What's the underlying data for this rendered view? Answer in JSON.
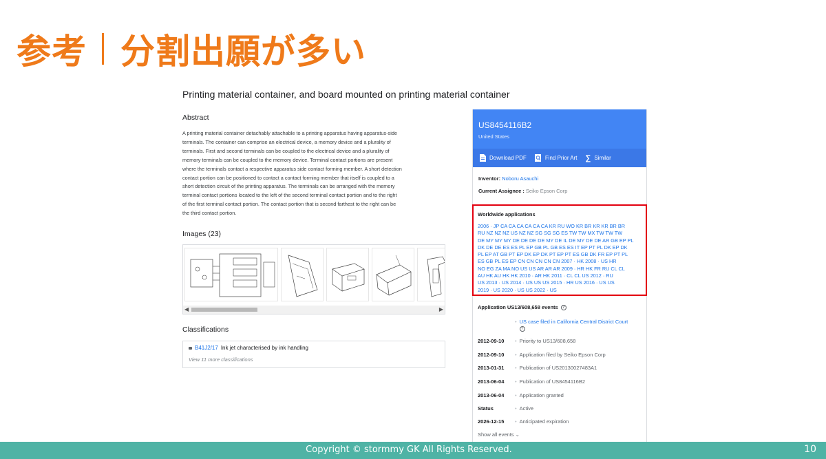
{
  "slide": {
    "title_left": "参考",
    "title_right": "分割出願が多い"
  },
  "patent": {
    "title": "Printing material container, and board mounted on printing material container",
    "abstract_heading": "Abstract",
    "abstract_lines": [
      "A printing material container detachably attachable to a printing apparatus having apparatus-side",
      "terminals. The container can comprise an electrical device, a memory device and a plurality of",
      "terminals. First and second terminals can be coupled to the electrical device and a plurality of",
      "memory terminals can be coupled to the memory device. Terminal contact portions are present",
      "where the terminals contact a respective apparatus side contact forming member. A short detection",
      "contact portion can be positioned to contact a contact forming member that itself is coupled to a",
      "short detection circuit of the printing apparatus. The terminals can be arranged with the memory",
      "terminal contact portions located to the left of the second terminal contact portion and to the right",
      "of the first terminal contact portion. The contact portion that is second farthest to the right can be",
      "the third contact portion."
    ],
    "images_heading": "Images (23)",
    "classifications_heading": "Classifications",
    "classification": {
      "code": "B41J2/17",
      "description": "Ink jet characterised by ink handling"
    },
    "more_classifications": "View 11 more classifications"
  },
  "card": {
    "number": "US8454116B2",
    "country": "United States",
    "actions": {
      "download": "Download PDF",
      "prior_art": "Find Prior Art",
      "similar": "Similar"
    },
    "inventor_label": "Inventor:",
    "inventor": "Noboru Asauchi",
    "assignee_label": "Current Assignee :",
    "assignee": "Seiko Epson Corp",
    "worldwide_title": "Worldwide applications",
    "worldwide_lines": [
      "2006 · JP CA CA CA CA CA CA KR RU WO KR BR KR KR BR BR",
      "RU NZ NZ NZ US NZ NZ SG SG SG ES TW TW MX TW TW TW",
      "DE MY MY MY DE DE DE DE MY DE IL DE MY DE DE AR GB EP PL",
      "DK DE DE ES ES PL EP GB PL GB ES ES IT EP PT PL DK EP DK",
      "PL EP AT GB PT EP DK EP DK PT EP PT ES GB DK FR EP PT PL",
      "ES GB PL ES EP CN CN CN CN CN   2007 · HK   2008 · US HR",
      "NO EG ZA MA NO US US AR AR AR   2009 · HR HK FR RU CL CL",
      "AU HK AU HK HK   2010 · AR HK   2011 · CL CL US   2012 · RU",
      "US   2013 · US   2014 · US US US   2015 · HR US   2016 · US US",
      "2019 · US   2020 · US US   2022 · US"
    ],
    "events_title": "Application US13/608,658 events",
    "events": [
      {
        "date": "",
        "desc": "US case filed in California Central District Court"
      },
      {
        "date": "2012-09-10",
        "desc": "Priority to US13/608,658"
      },
      {
        "date": "2012-09-10",
        "desc": "Application filed by Seiko Epson Corp"
      },
      {
        "date": "2013-01-31",
        "desc": "Publication of US20130027483A1"
      },
      {
        "date": "2013-06-04",
        "desc": "Publication of US8454116B2"
      },
      {
        "date": "2013-06-04",
        "desc": "Application granted"
      },
      {
        "date": "Status",
        "desc": "Active"
      },
      {
        "date": "2026-12-15",
        "desc": "Anticipated expiration"
      }
    ],
    "show_all": "Show all events ⌄"
  },
  "footer": {
    "copyright": "Copyright © stormmy GK All Rights Reserved.",
    "page": "10"
  },
  "colors": {
    "title_orange": "#ef7a1a",
    "footer_teal": "#4fb3a5",
    "card_blue": "#4285f4",
    "highlight_red": "#e3000f"
  }
}
